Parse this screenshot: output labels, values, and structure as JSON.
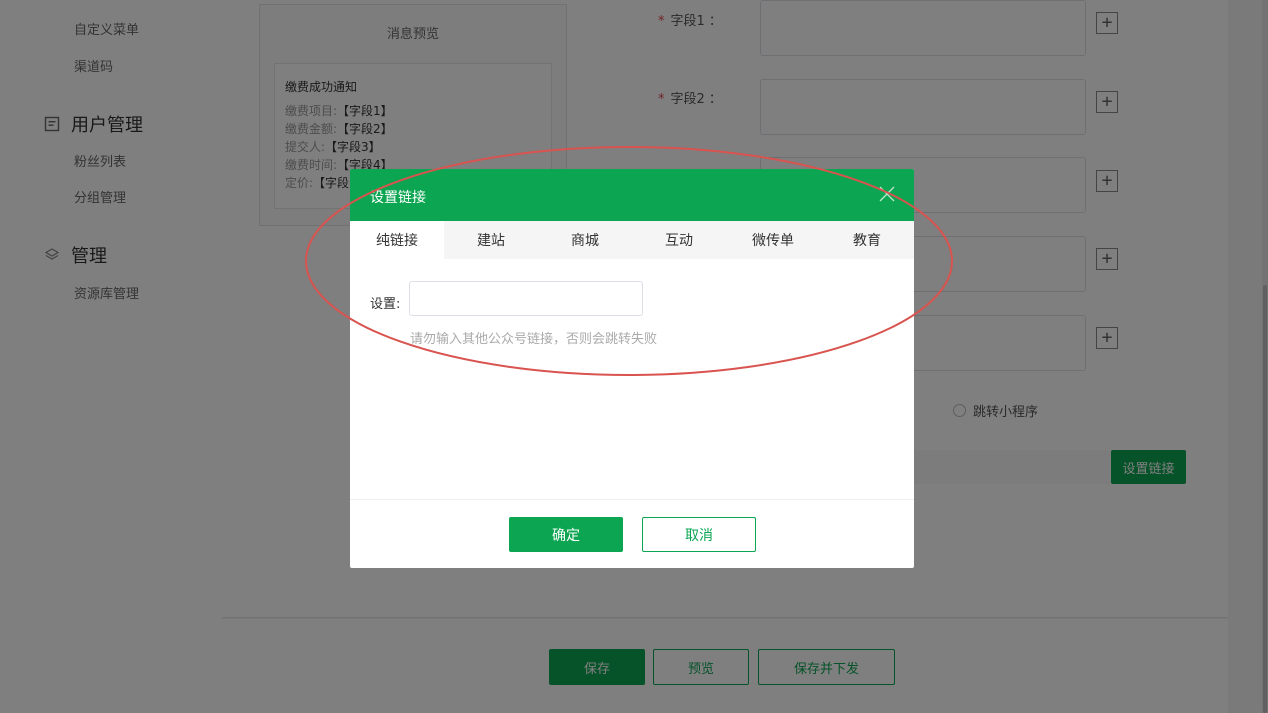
{
  "sidebar": {
    "items": [
      {
        "label": "自定义菜单"
      },
      {
        "label": "渠道码"
      },
      {
        "label": "粉丝列表"
      },
      {
        "label": "分组管理"
      },
      {
        "label": "资源库管理"
      }
    ],
    "groups": [
      {
        "label": "用户管理",
        "icon": "user-manage-icon"
      },
      {
        "label": "管理",
        "icon": "layers-icon"
      }
    ]
  },
  "preview": {
    "title": "消息预览",
    "card_title": "缴费成功通知",
    "lines": [
      {
        "label": "缴费项目:",
        "value": "【字段1】"
      },
      {
        "label": "缴费金额:",
        "value": "【字段2】"
      },
      {
        "label": "提交人:",
        "value": "【字段3】"
      },
      {
        "label": "缴费时间:",
        "value": "【字段4】"
      },
      {
        "label": "定价:",
        "value": "【字段"
      }
    ]
  },
  "form": {
    "required_mark": "*",
    "fields": [
      {
        "label": "字段1 ："
      },
      {
        "label": "字段2 ："
      }
    ],
    "plus_glyph": "+",
    "radio_partial": "\u0000",
    "radio_label": "跳转小程序",
    "set_link_button": "设置链接"
  },
  "footer": {
    "save": "保存",
    "preview": "预览",
    "save_send": "保存并下发"
  },
  "modal": {
    "title": "设置链接",
    "tabs": [
      {
        "label": "纯链接",
        "active": true
      },
      {
        "label": "建站"
      },
      {
        "label": "商城"
      },
      {
        "label": "互动"
      },
      {
        "label": "微传单"
      },
      {
        "label": "教育"
      }
    ],
    "field_label": "设置:",
    "input_value": "",
    "hint": "请勿输入其他公众号链接，否则会跳转失败",
    "ok": "确定",
    "cancel": "取消"
  },
  "colors": {
    "brand_green": "#0ca552",
    "annotation_red": "#d9534f",
    "overlay": "rgba(0,0,0,0.5)"
  }
}
